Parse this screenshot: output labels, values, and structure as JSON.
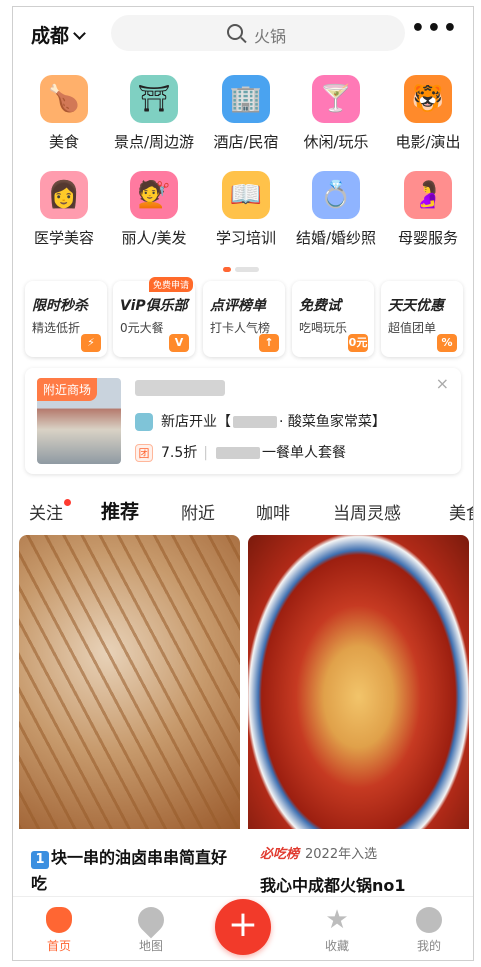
{
  "header": {
    "city": "成都",
    "search_placeholder": "火锅",
    "more": "•••"
  },
  "categories": [
    {
      "label": "美食",
      "icon": "roast-chicken-icon",
      "glyph": "🍗",
      "color": "#ffb06b"
    },
    {
      "label": "景点/周边游",
      "icon": "pagoda-icon",
      "glyph": "⛩",
      "color": "#7fd0c2"
    },
    {
      "label": "酒店/民宿",
      "icon": "hotel-building-icon",
      "glyph": "🏢",
      "color": "#4aa3f0"
    },
    {
      "label": "休闲/玩乐",
      "icon": "cocktail-icon",
      "glyph": "🍸",
      "color": "#ff79b6"
    },
    {
      "label": "电影/演出",
      "icon": "cat-face-icon",
      "glyph": "🐯",
      "color": "#ff8a2b"
    },
    {
      "label": "医学美容",
      "icon": "beauty-face-icon",
      "glyph": "👩",
      "color": "#ff9cae"
    },
    {
      "label": "丽人/美发",
      "icon": "hair-salon-icon",
      "glyph": "💇",
      "color": "#ff7aa0"
    },
    {
      "label": "学习培训",
      "icon": "open-book-icon",
      "glyph": "📖",
      "color": "#ffc24a"
    },
    {
      "label": "结婚/婚纱照",
      "icon": "diamond-ring-icon",
      "glyph": "💍",
      "color": "#8fb4ff"
    },
    {
      "label": "母婴服务",
      "icon": "pregnant-woman-icon",
      "glyph": "🤰",
      "color": "#ff8e8e"
    }
  ],
  "promos": [
    {
      "title": "限时秒杀",
      "sub": "精选低折",
      "badge": "⚡",
      "tag": ""
    },
    {
      "title": "ViP俱乐部",
      "sub": "0元大餐",
      "badge": "V",
      "tag": "免费申请"
    },
    {
      "title": "点评榜单",
      "sub": "打卡人气榜",
      "badge": "↑",
      "tag": ""
    },
    {
      "title": "免费试",
      "sub": "吃喝玩乐",
      "badge": "0元",
      "tag": ""
    },
    {
      "title": "天天优惠",
      "sub": "超值团单",
      "badge": "%",
      "tag": ""
    }
  ],
  "mall": {
    "tag": "附近商场",
    "line1_prefix": "新店开业【",
    "line1_suffix": "· 酸菜鱼家常菜】",
    "line2_mark": "团",
    "line2_discount": "7.5折",
    "line2_suffix": "一餐单人套餐",
    "close": "×"
  },
  "tabs": [
    "关注",
    "推荐",
    "附近",
    "咖啡",
    "当周灵感",
    "美食"
  ],
  "active_tab": "推荐",
  "feed": [
    {
      "num": "1",
      "caption": "块一串的油卤串串简直好吃"
    },
    {
      "brand": "必吃榜",
      "year": "2022年入选",
      "caption": "我心中成都火锅no1"
    }
  ],
  "nav": [
    {
      "label": "首页",
      "icon": "home-person-icon"
    },
    {
      "label": "地图",
      "icon": "map-pin-icon"
    },
    {
      "label": "+",
      "icon": "plus-icon"
    },
    {
      "label": "收藏",
      "icon": "star-icon"
    },
    {
      "label": "我的",
      "icon": "profile-icon"
    }
  ],
  "colors": {
    "accent": "#ff6633",
    "plus": "#f23a2a"
  }
}
